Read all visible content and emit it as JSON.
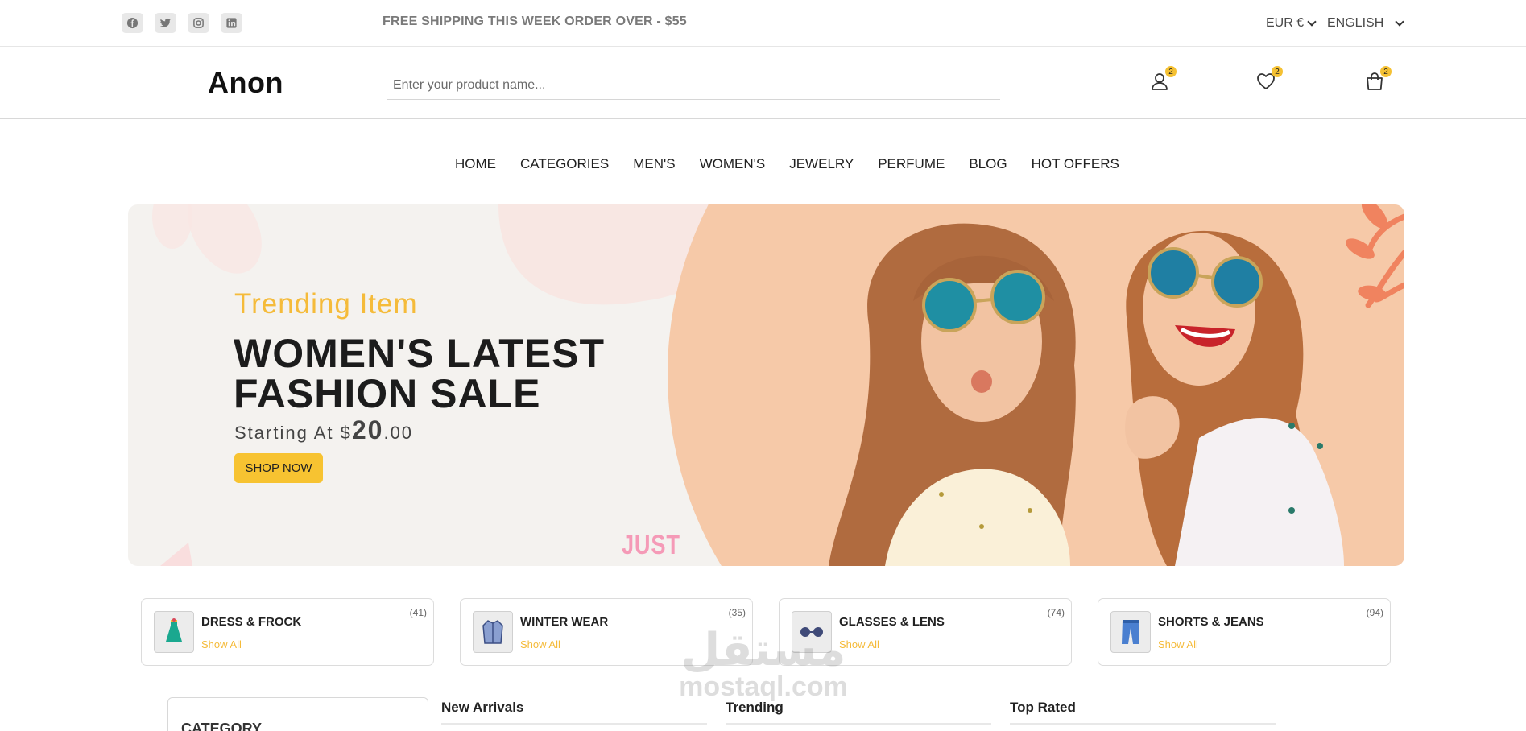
{
  "topbar": {
    "socials": [
      {
        "icon": "facebook-icon"
      },
      {
        "icon": "twitter-icon"
      },
      {
        "icon": "instagram-icon"
      },
      {
        "icon": "linkedin-icon"
      }
    ],
    "announcement": "FREE SHIPPING THIS WEEK ORDER OVER - $55",
    "currency": "EUR €",
    "language": "ENGLISH"
  },
  "header": {
    "logo": "Anon",
    "search_placeholder": "Enter your product name...",
    "user_badge": "2",
    "wishlist_badge": "2",
    "cart_badge": "2"
  },
  "nav": {
    "items": [
      "HOME",
      "CATEGORIES",
      "MEN'S",
      "WOMEN'S",
      "JEWELRY",
      "PERFUME",
      "BLOG",
      "HOT OFFERS"
    ]
  },
  "hero": {
    "subtitle": "Trending Item",
    "title": "WOMEN'S LATEST FASHION SALE",
    "price_prefix": "Starting At $",
    "price_big": "20",
    "price_suffix": ".00",
    "button": "SHOP NOW",
    "just_text": "JUST"
  },
  "categories": [
    {
      "name": "DRESS & FROCK",
      "link": "Show All",
      "count": "(41)",
      "icon": "dress-icon"
    },
    {
      "name": "WINTER WEAR",
      "link": "Show All",
      "count": "(35)",
      "icon": "jacket-icon"
    },
    {
      "name": "GLASSES & LENS",
      "link": "Show All",
      "count": "(74)",
      "icon": "glasses-icon"
    },
    {
      "name": "SHORTS & JEANS",
      "link": "Show All",
      "count": "(94)",
      "icon": "jeans-icon"
    }
  ],
  "sidebar": {
    "title": "CATEGORY"
  },
  "product_columns": [
    "New Arrivals",
    "Trending",
    "Top Rated"
  ],
  "watermark": {
    "arabic": "مستقل",
    "latin": "mostaql.com"
  },
  "colors": {
    "accent": "#f5bb3a",
    "button": "#f7c331",
    "badge": "#f5c133"
  }
}
